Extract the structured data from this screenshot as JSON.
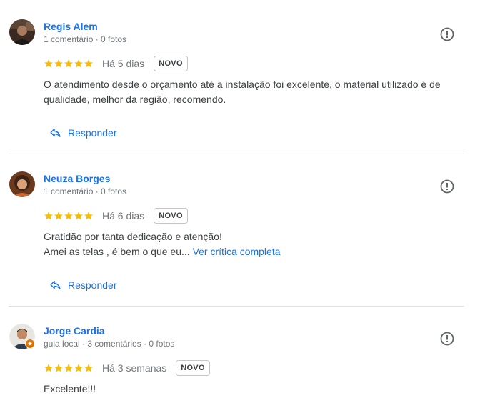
{
  "reviews": [
    {
      "name": "Regis Alem",
      "meta": "1 comentário · 0 fotos",
      "rating": 5,
      "when": "Há 5 dias",
      "badge": "NOVO",
      "text_line1": "O atendimento desde o orçamento até a instalação foi excelente, o material utilizado é de",
      "text_line2": "qualidade, melhor da região, recomendo.",
      "reply_label": "Responder",
      "avatar_icon": "person-photo-icon"
    },
    {
      "name": "Neuza Borges",
      "meta": "1 comentário · 0 fotos",
      "rating": 5,
      "when": "Há 6 dias",
      "badge": "NOVO",
      "text_line1": "Gratidão por tanta dedicação e atenção!",
      "text_line2": "Amei as telas , é bem o que eu...",
      "more_label": "Ver crítica completa",
      "reply_label": "Responder",
      "avatar_icon": "person-photo-icon"
    },
    {
      "name": "Jorge Cardia",
      "meta": "guia local · 3 comentários · 0 fotos",
      "rating": 5,
      "when": "Há 3 semanas",
      "badge": "NOVO",
      "text_line1": "Excelente!!!",
      "avatar_icon": "person-photo-icon",
      "local_guide_icon": "local-guide-badge-icon"
    }
  ],
  "colors": {
    "link": "#1a73e8",
    "star": "#fbbc04",
    "muted": "#70757a",
    "text": "#3c4043"
  },
  "icons": {
    "flag": "report-flag-icon",
    "reply": "reply-arrow-icon",
    "star": "star-icon"
  }
}
